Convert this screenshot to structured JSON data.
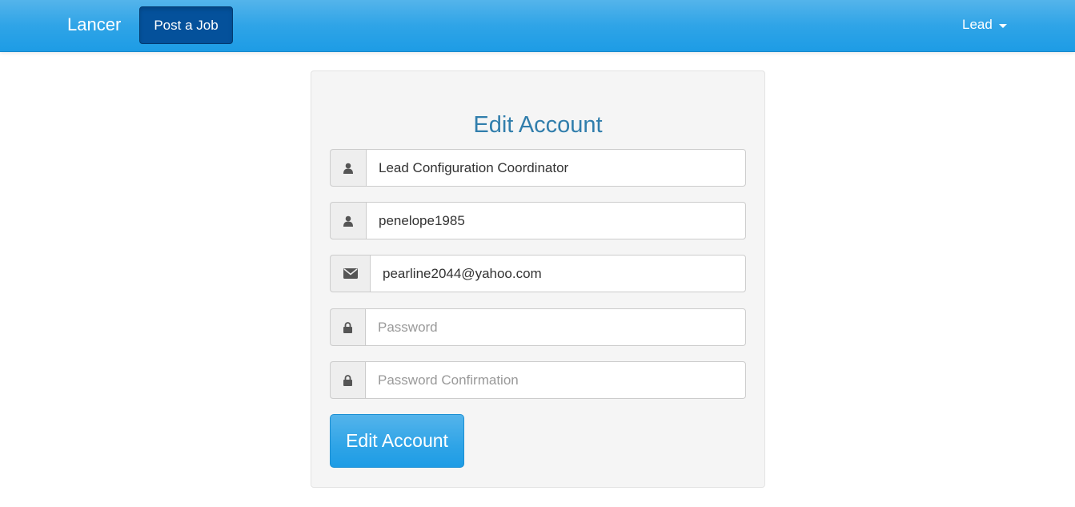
{
  "navbar": {
    "brand": "Lancer",
    "post_job_label": "Post a Job",
    "user_menu_label": "Lead"
  },
  "form": {
    "title": "Edit Account",
    "name_value": "Lead Configuration Coordinator",
    "username_value": "penelope1985",
    "email_value": "pearline2044@yahoo.com",
    "password_placeholder": "Password",
    "password_confirmation_placeholder": "Password Confirmation",
    "submit_label": "Edit Account"
  },
  "colors": {
    "navbar_accent": "#2fa4e7",
    "post_job_button": "#04519b",
    "title": "#317eac"
  },
  "icons": {
    "name": "user-icon",
    "username": "user-icon",
    "email": "envelope-icon",
    "password": "lock-icon",
    "password_confirmation": "lock-icon"
  }
}
